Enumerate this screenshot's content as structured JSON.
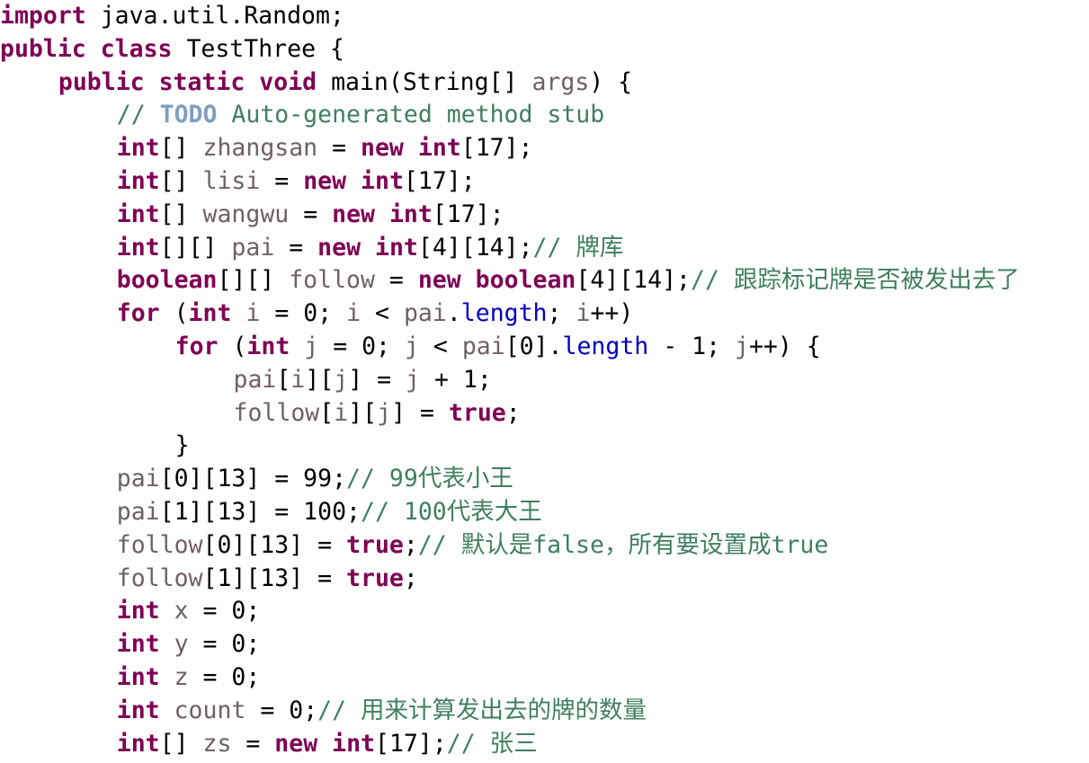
{
  "editor": {
    "language": "java",
    "class_name": "TestThree",
    "background": "#ffffff",
    "colors": {
      "keyword": "#7F0055",
      "comment": "#3F7F5F",
      "todo_tag": "#7F9FBF",
      "identifier": "#6F5F66",
      "field": "#0000C0",
      "punctuation": "#000000"
    }
  },
  "lines": [
    {
      "n": 1,
      "indent": 0,
      "text": "import java.util.Random;",
      "tokens": [
        {
          "t": "import",
          "c": "kw"
        },
        {
          "t": " java.util.Random;",
          "c": "plain"
        }
      ]
    },
    {
      "n": 2,
      "indent": 0,
      "text": "public class TestThree {",
      "tokens": [
        {
          "t": "public",
          "c": "kw"
        },
        {
          "t": " ",
          "c": "plain"
        },
        {
          "t": "class",
          "c": "kw"
        },
        {
          "t": " TestThree {",
          "c": "plain"
        }
      ]
    },
    {
      "n": 3,
      "indent": 4,
      "text": "public static void main(String[] args) {",
      "tokens": [
        {
          "t": "public",
          "c": "kw"
        },
        {
          "t": " ",
          "c": "plain"
        },
        {
          "t": "static",
          "c": "kw"
        },
        {
          "t": " ",
          "c": "plain"
        },
        {
          "t": "void",
          "c": "kw"
        },
        {
          "t": " main(String[] ",
          "c": "plain"
        },
        {
          "t": "args",
          "c": "ident"
        },
        {
          "t": ") {",
          "c": "plain"
        }
      ]
    },
    {
      "n": 4,
      "indent": 8,
      "text": "// TODO Auto-generated method stub",
      "tokens": [
        {
          "t": "// ",
          "c": "cmt"
        },
        {
          "t": "TODO",
          "c": "todo"
        },
        {
          "t": " Auto-generated method stub",
          "c": "cmt"
        }
      ]
    },
    {
      "n": 5,
      "indent": 8,
      "text": "int[] zhangsan = new int[17];",
      "tokens": [
        {
          "t": "int",
          "c": "kw"
        },
        {
          "t": "[] ",
          "c": "plain"
        },
        {
          "t": "zhangsan",
          "c": "ident"
        },
        {
          "t": " = ",
          "c": "plain"
        },
        {
          "t": "new",
          "c": "kw"
        },
        {
          "t": " ",
          "c": "plain"
        },
        {
          "t": "int",
          "c": "kw"
        },
        {
          "t": "[17];",
          "c": "plain"
        }
      ]
    },
    {
      "n": 6,
      "indent": 8,
      "text": "int[] lisi = new int[17];",
      "tokens": [
        {
          "t": "int",
          "c": "kw"
        },
        {
          "t": "[] ",
          "c": "plain"
        },
        {
          "t": "lisi",
          "c": "ident"
        },
        {
          "t": " = ",
          "c": "plain"
        },
        {
          "t": "new",
          "c": "kw"
        },
        {
          "t": " ",
          "c": "plain"
        },
        {
          "t": "int",
          "c": "kw"
        },
        {
          "t": "[17];",
          "c": "plain"
        }
      ]
    },
    {
      "n": 7,
      "indent": 8,
      "text": "int[] wangwu = new int[17];",
      "tokens": [
        {
          "t": "int",
          "c": "kw"
        },
        {
          "t": "[] ",
          "c": "plain"
        },
        {
          "t": "wangwu",
          "c": "ident"
        },
        {
          "t": " = ",
          "c": "plain"
        },
        {
          "t": "new",
          "c": "kw"
        },
        {
          "t": " ",
          "c": "plain"
        },
        {
          "t": "int",
          "c": "kw"
        },
        {
          "t": "[17];",
          "c": "plain"
        }
      ]
    },
    {
      "n": 8,
      "indent": 8,
      "text": "int[][] pai = new int[4][14];// 牌库",
      "tokens": [
        {
          "t": "int",
          "c": "kw"
        },
        {
          "t": "[][] ",
          "c": "plain"
        },
        {
          "t": "pai",
          "c": "ident"
        },
        {
          "t": " = ",
          "c": "plain"
        },
        {
          "t": "new",
          "c": "kw"
        },
        {
          "t": " ",
          "c": "plain"
        },
        {
          "t": "int",
          "c": "kw"
        },
        {
          "t": "[4][14];",
          "c": "plain"
        },
        {
          "t": "// 牌库",
          "c": "cmt"
        }
      ]
    },
    {
      "n": 9,
      "indent": 8,
      "text": "boolean[][] follow = new boolean[4][14];// 跟踪标记牌是否被发出去了",
      "tokens": [
        {
          "t": "boolean",
          "c": "kw"
        },
        {
          "t": "[][] ",
          "c": "plain"
        },
        {
          "t": "follow",
          "c": "ident"
        },
        {
          "t": " = ",
          "c": "plain"
        },
        {
          "t": "new",
          "c": "kw"
        },
        {
          "t": " ",
          "c": "plain"
        },
        {
          "t": "boolean",
          "c": "kw"
        },
        {
          "t": "[4][14];",
          "c": "plain"
        },
        {
          "t": "// 跟踪标记牌是否被发出去了",
          "c": "cmt"
        }
      ]
    },
    {
      "n": 10,
      "indent": 8,
      "text": "for (int i = 0; i < pai.length; i++)",
      "tokens": [
        {
          "t": "for",
          "c": "kw"
        },
        {
          "t": " (",
          "c": "plain"
        },
        {
          "t": "int",
          "c": "kw"
        },
        {
          "t": " ",
          "c": "plain"
        },
        {
          "t": "i",
          "c": "ident"
        },
        {
          "t": " = 0; ",
          "c": "plain"
        },
        {
          "t": "i",
          "c": "ident"
        },
        {
          "t": " < ",
          "c": "plain"
        },
        {
          "t": "pai",
          "c": "ident"
        },
        {
          "t": ".",
          "c": "plain"
        },
        {
          "t": "length",
          "c": "field"
        },
        {
          "t": "; ",
          "c": "plain"
        },
        {
          "t": "i",
          "c": "ident"
        },
        {
          "t": "++)",
          "c": "plain"
        }
      ]
    },
    {
      "n": 11,
      "indent": 12,
      "text": "for (int j = 0; j < pai[0].length - 1; j++) {",
      "tokens": [
        {
          "t": "for",
          "c": "kw"
        },
        {
          "t": " (",
          "c": "plain"
        },
        {
          "t": "int",
          "c": "kw"
        },
        {
          "t": " ",
          "c": "plain"
        },
        {
          "t": "j",
          "c": "ident"
        },
        {
          "t": " = 0; ",
          "c": "plain"
        },
        {
          "t": "j",
          "c": "ident"
        },
        {
          "t": " < ",
          "c": "plain"
        },
        {
          "t": "pai",
          "c": "ident"
        },
        {
          "t": "[0].",
          "c": "plain"
        },
        {
          "t": "length",
          "c": "field"
        },
        {
          "t": " - 1; ",
          "c": "plain"
        },
        {
          "t": "j",
          "c": "ident"
        },
        {
          "t": "++) {",
          "c": "plain"
        }
      ]
    },
    {
      "n": 12,
      "indent": 16,
      "text": "pai[i][j] = j + 1;",
      "tokens": [
        {
          "t": "pai",
          "c": "ident"
        },
        {
          "t": "[",
          "c": "plain"
        },
        {
          "t": "i",
          "c": "ident"
        },
        {
          "t": "][",
          "c": "plain"
        },
        {
          "t": "j",
          "c": "ident"
        },
        {
          "t": "] = ",
          "c": "plain"
        },
        {
          "t": "j",
          "c": "ident"
        },
        {
          "t": " + 1;",
          "c": "plain"
        }
      ]
    },
    {
      "n": 13,
      "indent": 16,
      "text": "follow[i][j] = true;",
      "tokens": [
        {
          "t": "follow",
          "c": "ident"
        },
        {
          "t": "[",
          "c": "plain"
        },
        {
          "t": "i",
          "c": "ident"
        },
        {
          "t": "][",
          "c": "plain"
        },
        {
          "t": "j",
          "c": "ident"
        },
        {
          "t": "] = ",
          "c": "plain"
        },
        {
          "t": "true",
          "c": "kw"
        },
        {
          "t": ";",
          "c": "plain"
        }
      ]
    },
    {
      "n": 14,
      "indent": 12,
      "text": "}",
      "tokens": [
        {
          "t": "}",
          "c": "plain"
        }
      ]
    },
    {
      "n": 15,
      "indent": 8,
      "text": "pai[0][13] = 99;// 99代表小王",
      "tokens": [
        {
          "t": "pai",
          "c": "ident"
        },
        {
          "t": "[0][13] = 99;",
          "c": "plain"
        },
        {
          "t": "// 99代表小王",
          "c": "cmt"
        }
      ]
    },
    {
      "n": 16,
      "indent": 8,
      "text": "pai[1][13] = 100;// 100代表大王",
      "tokens": [
        {
          "t": "pai",
          "c": "ident"
        },
        {
          "t": "[1][13] = 100;",
          "c": "plain"
        },
        {
          "t": "// 100代表大王",
          "c": "cmt"
        }
      ]
    },
    {
      "n": 17,
      "indent": 8,
      "text": "follow[0][13] = true;// 默认是false，所有要设置成true",
      "tokens": [
        {
          "t": "follow",
          "c": "ident"
        },
        {
          "t": "[0][13] = ",
          "c": "plain"
        },
        {
          "t": "true",
          "c": "kw"
        },
        {
          "t": ";",
          "c": "plain"
        },
        {
          "t": "// 默认是false，所有要设置成true",
          "c": "cmt"
        }
      ]
    },
    {
      "n": 18,
      "indent": 8,
      "text": "follow[1][13] = true;",
      "tokens": [
        {
          "t": "follow",
          "c": "ident"
        },
        {
          "t": "[1][13] = ",
          "c": "plain"
        },
        {
          "t": "true",
          "c": "kw"
        },
        {
          "t": ";",
          "c": "plain"
        }
      ]
    },
    {
      "n": 19,
      "indent": 8,
      "text": "int x = 0;",
      "tokens": [
        {
          "t": "int",
          "c": "kw"
        },
        {
          "t": " ",
          "c": "plain"
        },
        {
          "t": "x",
          "c": "ident"
        },
        {
          "t": " = 0;",
          "c": "plain"
        }
      ]
    },
    {
      "n": 20,
      "indent": 8,
      "text": "int y = 0;",
      "tokens": [
        {
          "t": "int",
          "c": "kw"
        },
        {
          "t": " ",
          "c": "plain"
        },
        {
          "t": "y",
          "c": "ident"
        },
        {
          "t": " = 0;",
          "c": "plain"
        }
      ]
    },
    {
      "n": 21,
      "indent": 8,
      "text": "int z = 0;",
      "tokens": [
        {
          "t": "int",
          "c": "kw"
        },
        {
          "t": " ",
          "c": "plain"
        },
        {
          "t": "z",
          "c": "ident"
        },
        {
          "t": " = 0;",
          "c": "plain"
        }
      ]
    },
    {
      "n": 22,
      "indent": 8,
      "text": "int count = 0;// 用来计算发出去的牌的数量",
      "tokens": [
        {
          "t": "int",
          "c": "kw"
        },
        {
          "t": " ",
          "c": "plain"
        },
        {
          "t": "count",
          "c": "ident"
        },
        {
          "t": " = 0;",
          "c": "plain"
        },
        {
          "t": "// 用来计算发出去的牌的数量",
          "c": "cmt"
        }
      ]
    },
    {
      "n": 23,
      "indent": 8,
      "text": "int[] zs = new int[17];// 张三",
      "tokens": [
        {
          "t": "int",
          "c": "kw"
        },
        {
          "t": "[] ",
          "c": "plain"
        },
        {
          "t": "zs",
          "c": "ident"
        },
        {
          "t": " = ",
          "c": "plain"
        },
        {
          "t": "new",
          "c": "kw"
        },
        {
          "t": " ",
          "c": "plain"
        },
        {
          "t": "int",
          "c": "kw"
        },
        {
          "t": "[17];",
          "c": "plain"
        },
        {
          "t": "// 张三",
          "c": "cmt"
        }
      ]
    }
  ]
}
